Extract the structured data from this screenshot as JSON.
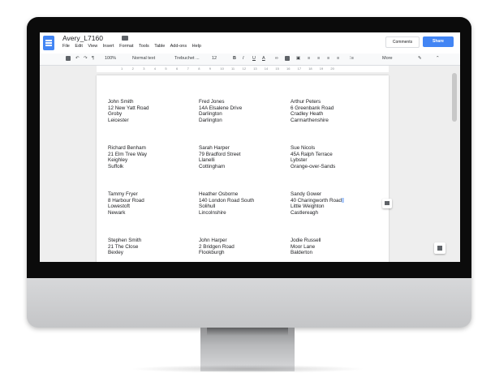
{
  "doc": {
    "title": "Avery_L7160",
    "menu": [
      "File",
      "Edit",
      "View",
      "Insert",
      "Format",
      "Tools",
      "Table",
      "Add-ons",
      "Help"
    ],
    "comments_label": "Comments",
    "share_label": "Share"
  },
  "toolbar": {
    "zoom": "100%",
    "style": "Normal text",
    "font": "Trebuchet ...",
    "font_size": "12",
    "bold": "B",
    "italic": "I",
    "underline": "U",
    "text_color": "A",
    "more": "More"
  },
  "ruler": [
    "1",
    "2",
    "3",
    "4",
    "5",
    "6",
    "7",
    "8",
    "9",
    "10",
    "11",
    "12",
    "13",
    "14",
    "15",
    "16",
    "17",
    "18",
    "19",
    "20"
  ],
  "labels": [
    {
      "lines": [
        "John Smith",
        "12 New Yatt Road",
        "Groby",
        "Leicester"
      ]
    },
    {
      "lines": [
        "Fred Jones",
        "14A Elsalene Drive",
        "Darlington",
        "Darlington"
      ]
    },
    {
      "lines": [
        "Arthur Peters",
        "6 Greenbank Road",
        "Cradley Heath",
        "Carmarthenshire"
      ]
    },
    {
      "lines": [
        "Richard Benham",
        "21 Elm Tree Way",
        "Keighley",
        "Suffolk"
      ]
    },
    {
      "lines": [
        "Sarah Harper",
        "79 Bradford Street",
        "Llanelli",
        "Cottingham"
      ]
    },
    {
      "lines": [
        "Sue Nicols",
        "45A Ralph Terrace",
        "Lybster",
        "Grange-over-Sands"
      ]
    },
    {
      "lines": [
        "Tammy Fryer",
        "8 Harbour Road",
        "Lowestoft",
        "Newark"
      ]
    },
    {
      "lines": [
        "Heather Osborne",
        "140 London Road South",
        "Solihull",
        "Lincolnshire"
      ]
    },
    {
      "lines": [
        "Sandy Gower",
        "40 Charingworth Road",
        "Little Weighton",
        "Castlereagh"
      ]
    },
    {
      "lines": [
        "Stephen Smith",
        "21 The Close",
        "Bexley",
        ""
      ]
    },
    {
      "lines": [
        "John Harper",
        "2 Bridgen Road",
        "Flookburgh",
        ""
      ]
    },
    {
      "lines": [
        "Jodie Russell",
        "Moor Lane",
        "Balderton",
        ""
      ]
    }
  ]
}
